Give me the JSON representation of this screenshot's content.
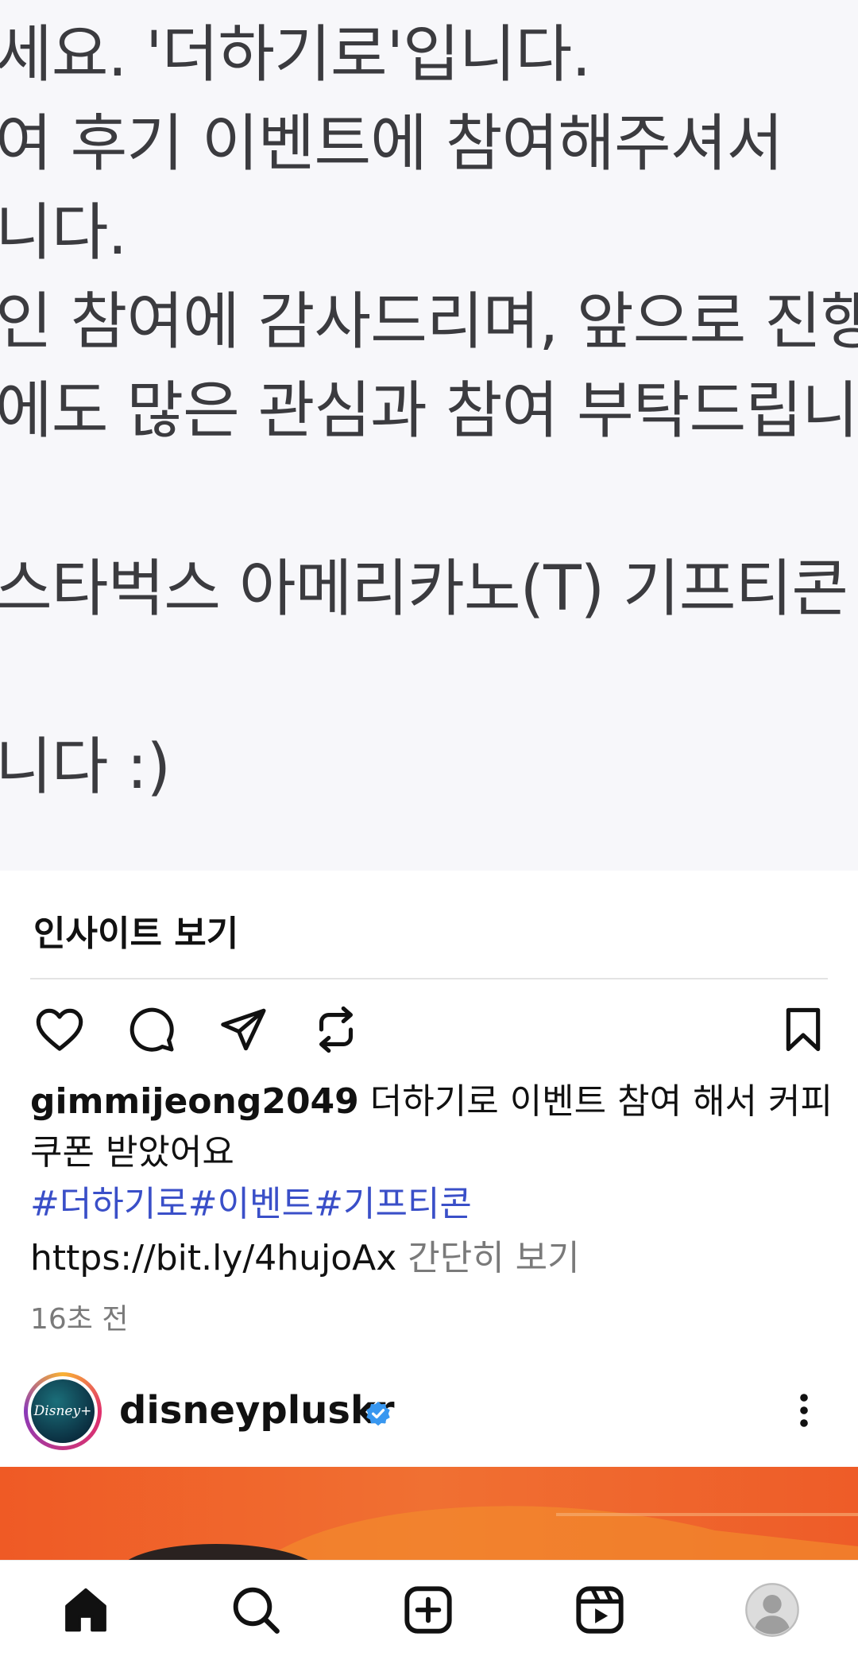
{
  "post_image": {
    "lines": [
      "세요. '더하기로'입니다.",
      "여 후기 이벤트에 참여해주셔서",
      "니다.",
      "인 참여에 감사드리며, 앞으로 진행",
      "에도 많은 관심과 참여 부탁드립니다",
      "",
      "스타벅스 아메리카노(T) 기프티콘",
      "",
      "니다 :)"
    ]
  },
  "insight_label": "인사이트 보기",
  "caption": {
    "username": "gimmijeong2049",
    "text": "더하기로 이벤트 참여 해서 커피 쿠폰 받았어요",
    "hashtags": "#더하기로#이벤트#기프티콘",
    "link": "https://bit.ly/4hujoAx",
    "more_label": "간단히 보기",
    "time": "16초 전"
  },
  "next_post": {
    "username": "disneypluskr",
    "avatar_text": "Disney+"
  },
  "colors": {
    "hashtag": "#3a4fc8",
    "verified": "#3897f0",
    "media_orange": "#ef5a25"
  },
  "icons": {
    "actions": [
      "heart-icon",
      "comment-icon",
      "share-icon",
      "repost-icon",
      "bookmark-icon"
    ],
    "tabs": [
      "home-icon",
      "search-icon",
      "create-icon",
      "reels-icon",
      "profile-icon"
    ]
  }
}
